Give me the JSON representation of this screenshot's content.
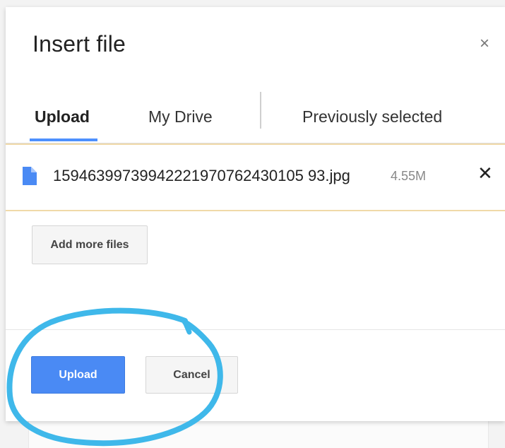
{
  "dialog": {
    "title": "Insert file",
    "close_glyph": "×"
  },
  "tabs": [
    {
      "label": "Upload",
      "active": true
    },
    {
      "label": "My Drive",
      "active": false
    },
    {
      "label": "Previously selected",
      "active": false
    }
  ],
  "file": {
    "name": "15946399739942221970762430105 93.jpg",
    "size": "4.55M",
    "remove_glyph": "✕",
    "icon": "document-icon"
  },
  "buttons": {
    "add_more": "Add more files",
    "upload": "Upload",
    "cancel": "Cancel"
  },
  "colors": {
    "accent": "#4d90fe",
    "primary_button": "#4a8af4",
    "annotation": "#3fb8ea",
    "file_row_border": "#f0d9a8"
  }
}
